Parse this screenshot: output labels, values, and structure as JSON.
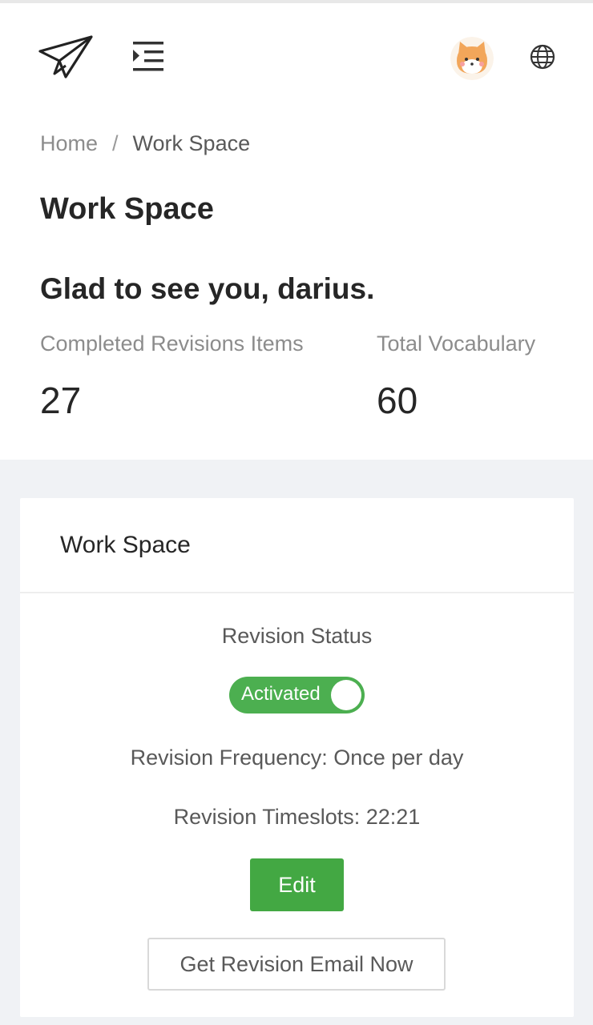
{
  "topbar": {
    "logo_icon": "paper-plane-icon",
    "menu_icon": "indent-menu-icon",
    "avatar_icon": "shiba-avatar",
    "language_icon": "globe-icon"
  },
  "breadcrumb": {
    "home": "Home",
    "separator": "/",
    "current": "Work Space"
  },
  "page": {
    "title": "Work Space",
    "greeting": "Glad to see you, darius."
  },
  "stats": {
    "completed_label": "Completed Revisions Items",
    "completed_value": "27",
    "vocab_label": "Total Vocabulary",
    "vocab_value": "60"
  },
  "card": {
    "title": "Work Space",
    "status_label": "Revision Status",
    "toggle_text": "Activated",
    "toggle_on": true,
    "frequency": "Revision Frequency: Once per day",
    "timeslots": "Revision Timeslots: 22:21",
    "edit_label": "Edit",
    "email_label": "Get Revision Email Now"
  },
  "colors": {
    "accent_green": "#43a843",
    "background": "#f0f2f5"
  }
}
